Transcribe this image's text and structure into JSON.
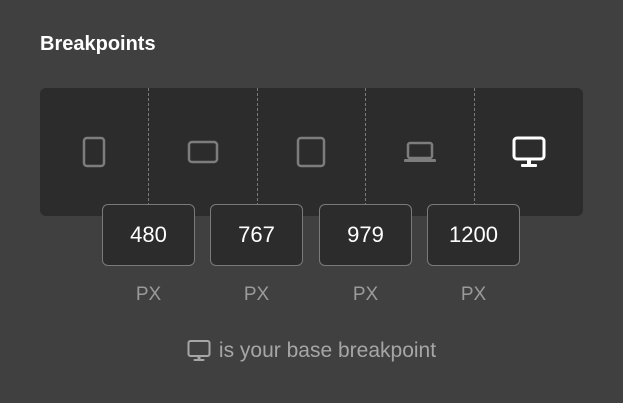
{
  "panel": {
    "title": "Breakpoints",
    "devices": [
      {
        "name": "mobile-portrait",
        "icon": "phone-icon",
        "active": false
      },
      {
        "name": "mobile-landscape",
        "icon": "tablet-landscape-icon",
        "active": false
      },
      {
        "name": "tablet",
        "icon": "tablet-icon",
        "active": false
      },
      {
        "name": "laptop",
        "icon": "laptop-icon",
        "active": false
      },
      {
        "name": "desktop",
        "icon": "desktop-icon",
        "active": true
      }
    ],
    "breakpoints": [
      {
        "value": "480",
        "unit": "PX"
      },
      {
        "value": "767",
        "unit": "PX"
      },
      {
        "value": "979",
        "unit": "PX"
      },
      {
        "value": "1200",
        "unit": "PX"
      }
    ],
    "footer_text": "is your base breakpoint",
    "footer_icon": "desktop-icon"
  },
  "colors": {
    "background": "#404040",
    "bar": "#2c2c2c",
    "active_icon": "#ffffff",
    "inactive_icon": "#7d7d7d",
    "muted_text": "#9a9a9a"
  }
}
